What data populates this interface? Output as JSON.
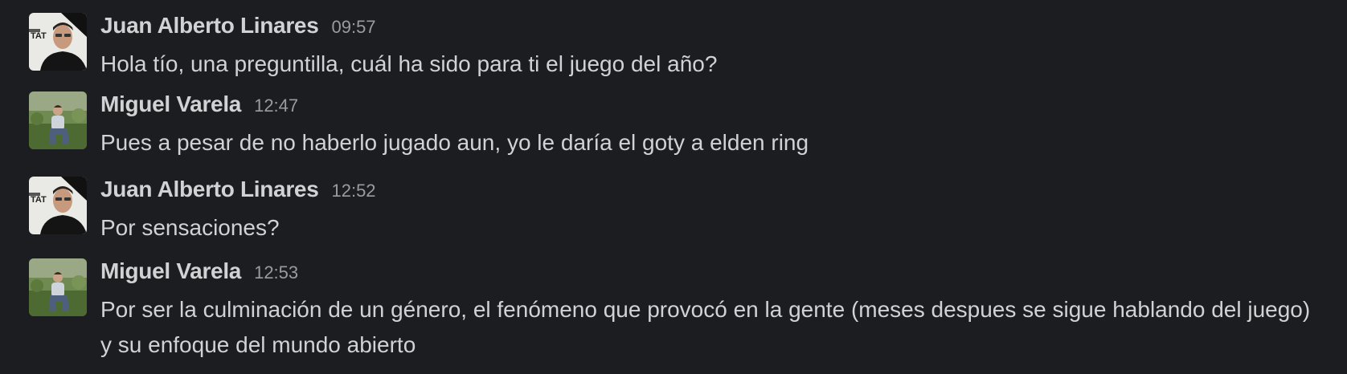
{
  "messages": [
    {
      "author": "Juan Alberto Linares",
      "time": "09:57",
      "text": "Hola tío, una preguntilla, cuál ha sido para ti el juego del año?",
      "avatar": "avatar-juan-icon",
      "avatar_text": "TAT"
    },
    {
      "author": "Miguel Varela",
      "time": "12:47",
      "text": "Pues a pesar de no haberlo jugado aun, yo le daría el goty a elden ring",
      "avatar": "avatar-miguel-icon"
    },
    {
      "author": "Juan Alberto Linares",
      "time": "12:52",
      "text": "Por sensaciones?",
      "avatar": "avatar-juan-icon",
      "avatar_text": "TAT"
    },
    {
      "author": "Miguel Varela",
      "time": "12:53",
      "text": "Por ser la culminación de un género, el fenómeno que provocó en la gente (meses despues se sigue hablando del juego) y su enfoque del mundo abierto",
      "avatar": "avatar-miguel-icon"
    }
  ],
  "colors": {
    "background": "#1b1d21",
    "text": "#d1d2d3",
    "timestamp": "#9a9b9e"
  }
}
